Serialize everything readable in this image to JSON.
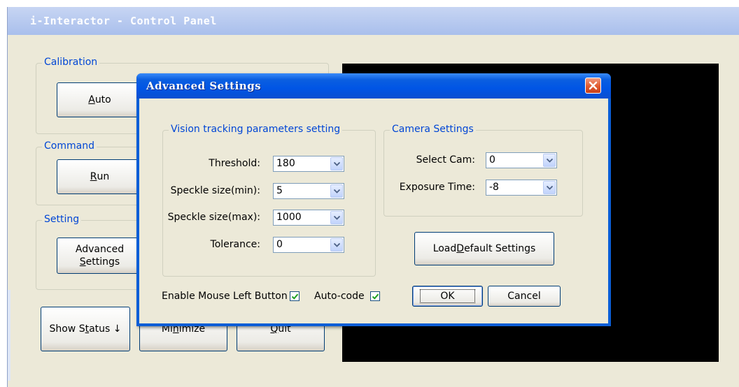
{
  "main": {
    "title": "i-Interactor - Control Panel",
    "groups": {
      "calibration": "Calibration",
      "command": "Command",
      "setting": "Setting"
    },
    "buttons": {
      "auto": {
        "pre": "",
        "key": "A",
        "post": "uto"
      },
      "run": {
        "pre": "",
        "key": "R",
        "post": "un"
      },
      "advanced_line1": "Advanced",
      "advanced_line2": {
        "pre": "",
        "key": "S",
        "post": "ettings"
      },
      "show_status": {
        "pre": "Show S",
        "key": "t",
        "post": "atus ↓"
      },
      "minimize": {
        "pre": "Mi",
        "key": "n",
        "post": "imize"
      },
      "quit": {
        "pre": "",
        "key": "Q",
        "post": "uit"
      }
    }
  },
  "dialog": {
    "title": "Advanced Settings",
    "vision_group": "Vision tracking parameters setting",
    "camera_group": "Camera Settings",
    "fields": {
      "threshold": {
        "label": "Threshold:",
        "value": "180"
      },
      "speckle_min": {
        "label": "Speckle size(min):",
        "value": "5"
      },
      "speckle_max": {
        "label": "Speckle size(max):",
        "value": "1000"
      },
      "tolerance": {
        "label": "Tolerance:",
        "value": "0"
      },
      "select_cam": {
        "label": "Select Cam:",
        "value": "0"
      },
      "exposure": {
        "label": "Exposure Time:",
        "value": "-8"
      }
    },
    "checkboxes": {
      "mouse_left": {
        "label": "Enable Mouse Left Button",
        "checked": true
      },
      "auto_code": {
        "label": "Auto-code",
        "checked": true
      }
    },
    "buttons": {
      "load_default": {
        "pre": "Load ",
        "key": "D",
        "post": "efault Settings"
      },
      "ok": "OK",
      "cancel": "Cancel"
    }
  },
  "colors": {
    "window_bg": "#ece9d8",
    "group_label": "#0046d5",
    "dialog_title": "#0055e5",
    "check_mark": "#21a121"
  }
}
